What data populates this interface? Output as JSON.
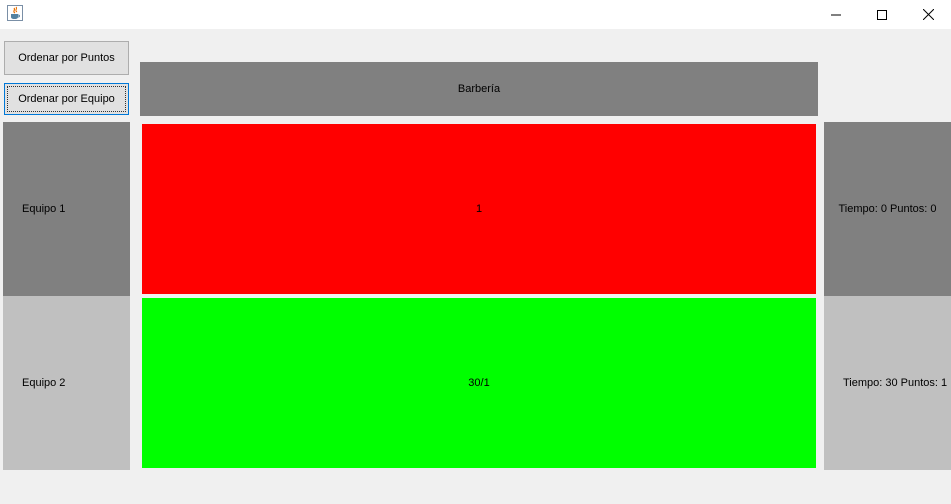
{
  "window": {
    "app_icon": "java-icon"
  },
  "controls": {
    "minimize": "minimize-icon",
    "maximize": "maximize-icon",
    "close": "close-icon"
  },
  "buttons": {
    "sort_points": "Ordenar por Puntos",
    "sort_team": "Ordenar por Equipo"
  },
  "header": {
    "title": "Barbería"
  },
  "rows": [
    {
      "team": "Equipo 1",
      "value": "1",
      "stats": "Tiempo: 0 Puntos: 0",
      "bar_color": "#ff0000",
      "side_color": "#808080"
    },
    {
      "team": "Equipo 2",
      "value": "30/1",
      "stats": "Tiempo: 30 Puntos: 1",
      "bar_color": "#00ff00",
      "side_color": "#c0c0c0"
    }
  ],
  "colors": {
    "header_bg": "#808080",
    "window_bg": "#f0f0f0",
    "focus_border": "#0078d7"
  }
}
